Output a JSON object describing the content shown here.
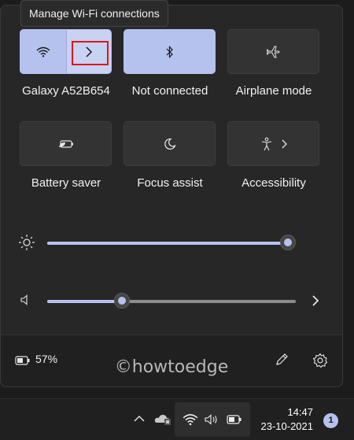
{
  "tooltip": {
    "text": "Manage Wi-Fi connections"
  },
  "tiles": [
    {
      "label": "Galaxy A52B654",
      "icon": "wifi-icon",
      "state": "on"
    },
    {
      "label": "Not connected",
      "icon": "bluetooth-icon",
      "state": "on"
    },
    {
      "label": "Airplane mode",
      "icon": "airplane-icon",
      "state": "off"
    },
    {
      "label": "Battery saver",
      "icon": "battery-saver-icon",
      "state": "off"
    },
    {
      "label": "Focus assist",
      "icon": "moon-icon",
      "state": "off"
    },
    {
      "label": "Accessibility",
      "icon": "accessibility-icon",
      "state": "off"
    }
  ],
  "brightness": {
    "icon": "sun-icon",
    "level": 1.0
  },
  "volume": {
    "icon": "speaker-icon",
    "level": 0.3
  },
  "footer": {
    "battery_percent": "57%",
    "edit_icon": "pencil-icon",
    "settings_icon": "gear-icon"
  },
  "watermark": "©howtoedge",
  "taskbar": {
    "time": "14:47",
    "date": "23-10-2021",
    "notification_count": "1"
  },
  "colors": {
    "accent": "#b5c2ed",
    "panel": "#272727",
    "highlight_box": "#e0141a"
  }
}
